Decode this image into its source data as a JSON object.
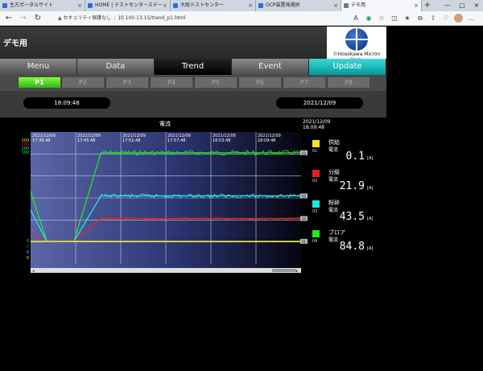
{
  "browser": {
    "tabs": [
      {
        "label": "生方ポータルサイト"
      },
      {
        "label": "HOME | テストセンターステー"
      },
      {
        "label": "大阪テストセンター"
      },
      {
        "label": "OCP装置発選択"
      },
      {
        "label": "デモ用"
      }
    ],
    "security_label": "セキュリティ保護なし",
    "url": "10.100.13.15/trend_p1.html"
  },
  "app": {
    "title": "デモ用",
    "logo_text": "©Hosokawa Micron Corp."
  },
  "menu": [
    {
      "label": "Menu"
    },
    {
      "label": "Data"
    },
    {
      "label": "Trend"
    },
    {
      "label": "Event"
    },
    {
      "label": "Update"
    }
  ],
  "pages": [
    "P1",
    "P2",
    "P3",
    "P4",
    "P5",
    "P6",
    "P7",
    "P8"
  ],
  "time_left": "18:09:48",
  "time_right": "2021/12/09",
  "chart_header": {
    "title": "電流",
    "date": "2021/12/09",
    "time": "18:09:48"
  },
  "chart_data": {
    "type": "line",
    "title": "電流",
    "x_ticks": [
      {
        "date": "2021/12/09",
        "time": "17:39:48"
      },
      {
        "date": "2021/12/09",
        "time": "17:45:48"
      },
      {
        "date": "2021/12/09",
        "time": "17:51:48"
      },
      {
        "date": "2021/12/09",
        "time": "17:57:48"
      },
      {
        "date": "2021/12/09",
        "time": "18:03:48"
      },
      {
        "date": "2021/12/09",
        "time": "18:09:48"
      }
    ],
    "left_axis_labels": [
      "100",
      "100",
      "100",
      "100",
      "0",
      "0",
      "0",
      "0"
    ],
    "right_marker_labels": [
      "02",
      "03",
      "04",
      "01"
    ],
    "series": [
      {
        "name": "ブロア",
        "color": "#22ee22",
        "points": [
          [
            0,
            48
          ],
          [
            6,
            0
          ],
          [
            16,
            0
          ],
          [
            26,
            84.8
          ],
          [
            100,
            84.8
          ]
        ]
      },
      {
        "name": "粉砕",
        "color": "#22eeee",
        "points": [
          [
            0,
            30
          ],
          [
            6,
            0
          ],
          [
            16,
            0
          ],
          [
            26,
            43.5
          ],
          [
            100,
            43.5
          ]
        ]
      },
      {
        "name": "分級",
        "color": "#ee2222",
        "points": [
          [
            0,
            8
          ],
          [
            6,
            0
          ],
          [
            16,
            0
          ],
          [
            26,
            21.9
          ],
          [
            100,
            21.9
          ]
        ]
      },
      {
        "name": "供給",
        "color": "#eeee22",
        "points": [
          [
            0,
            0.1
          ],
          [
            100,
            0.1
          ]
        ]
      }
    ],
    "ylim": [
      0,
      100
    ]
  },
  "legend": [
    {
      "num": "01",
      "name": "供給",
      "measure": "電流",
      "value": "0.1",
      "unit": "[A]",
      "color": "#f5e62a"
    },
    {
      "num": "02",
      "name": "分級",
      "measure": "電流",
      "value": "21.9",
      "unit": "[A]",
      "color": "#e62020"
    },
    {
      "num": "03",
      "name": "粉砕",
      "measure": "電流",
      "value": "43.5",
      "unit": "[A]",
      "color": "#22e6e6"
    },
    {
      "num": "04",
      "name": "ブロア",
      "measure": "電流",
      "value": "84.8",
      "unit": "[A]",
      "color": "#22e622"
    }
  ]
}
